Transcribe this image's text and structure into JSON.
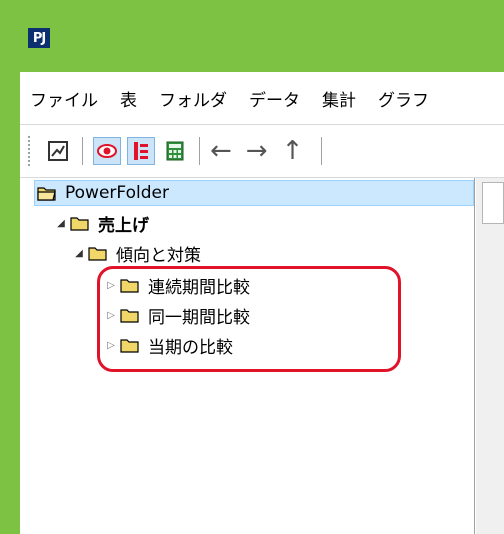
{
  "app": {
    "logo": "PJ"
  },
  "menu": [
    "ファイル",
    "表",
    "フォルダ",
    "データ",
    "集計",
    "グラフ"
  ],
  "toolbar": {
    "buttons": [
      {
        "icon": "chart-icon",
        "pressed": false
      },
      {
        "icon": "eye-icon",
        "pressed": true
      },
      {
        "icon": "tree-view-icon",
        "pressed": true
      },
      {
        "icon": "calculator-icon",
        "pressed": false
      }
    ],
    "nav": {
      "back": "←",
      "forward": "→",
      "up": "↑"
    }
  },
  "tree": {
    "root": "PowerFolder",
    "level1": "売上げ",
    "level2": "傾向と対策",
    "children": [
      "連続期間比較",
      "同一期間比較",
      "当期の比較"
    ]
  },
  "colors": {
    "frame": "#7dc243",
    "selection": "#cce8ff",
    "highlight": "#e0132a",
    "folder": "#f1d76a"
  }
}
